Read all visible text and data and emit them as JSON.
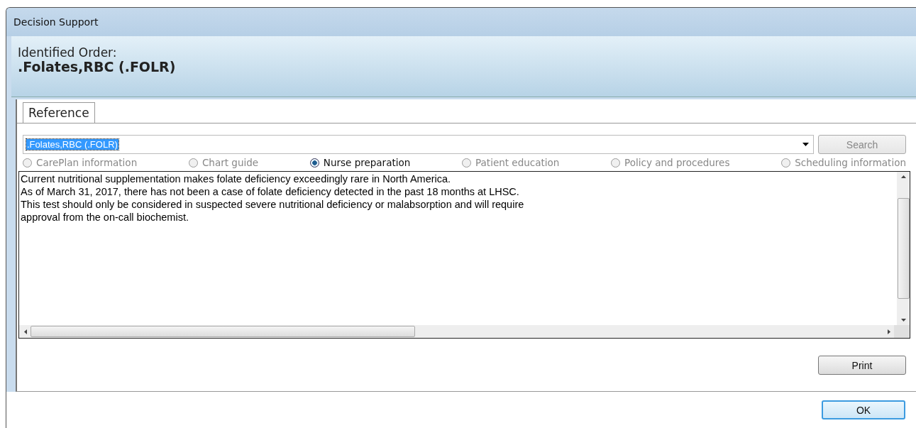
{
  "window": {
    "title": "Decision Support"
  },
  "header": {
    "label": "Identified Order:",
    "order": ".Folates,RBC (.FOLR)"
  },
  "tabs": [
    {
      "label": "Reference",
      "selected": true
    }
  ],
  "search": {
    "value": ".Folates,RBC (.FOLR)",
    "button": "Search"
  },
  "categories": [
    {
      "label": "CarePlan information",
      "selected": false,
      "disabled": true
    },
    {
      "label": "Chart guide",
      "selected": false,
      "disabled": true
    },
    {
      "label": "Nurse preparation",
      "selected": true,
      "disabled": false
    },
    {
      "label": "Patient education",
      "selected": false,
      "disabled": true
    },
    {
      "label": "Policy and procedures",
      "selected": false,
      "disabled": true
    },
    {
      "label": "Scheduling information",
      "selected": false,
      "disabled": true
    }
  ],
  "content": [
    "Current nutritional supplementation makes folate deficiency exceedingly rare in North America.",
    "As of March 31, 2017, there has not been a case of folate deficiency detected in the past 18 months at LHSC.",
    "This test should only be considered in suspected severe nutritional deficiency or malabsorption and will require",
    "approval from the on-call biochemist."
  ],
  "buttons": {
    "print": "Print",
    "ok": "OK"
  }
}
